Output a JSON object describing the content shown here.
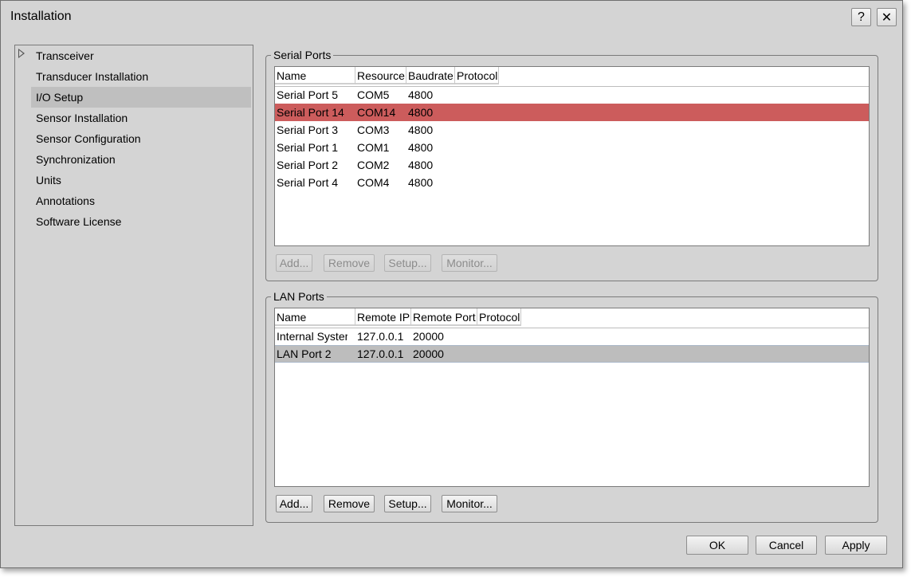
{
  "window": {
    "title": "Installation",
    "help_label": "?",
    "close_label": "✕"
  },
  "nav": {
    "items": [
      {
        "label": "Transceiver"
      },
      {
        "label": "Transducer Installation"
      },
      {
        "label": "I/O Setup"
      },
      {
        "label": "Sensor Installation"
      },
      {
        "label": "Sensor Configuration"
      },
      {
        "label": "Synchronization"
      },
      {
        "label": "Units"
      },
      {
        "label": "Annotations"
      },
      {
        "label": "Software License"
      }
    ],
    "selected": "I/O Setup"
  },
  "serial": {
    "label": "Serial Ports",
    "columns": [
      "Name",
      "Resource",
      "Baudrate",
      "Protocol"
    ],
    "rows": [
      {
        "name": "Serial Port 5",
        "resource": "COM5",
        "baudrate": "4800",
        "protocol": ""
      },
      {
        "name": "Serial Port 14",
        "resource": "COM14",
        "baudrate": "4800",
        "protocol": ""
      },
      {
        "name": "Serial Port 3",
        "resource": "COM3",
        "baudrate": "4800",
        "protocol": ""
      },
      {
        "name": "Serial Port 1",
        "resource": "COM1",
        "baudrate": "4800",
        "protocol": ""
      },
      {
        "name": "Serial Port 2",
        "resource": "COM2",
        "baudrate": "4800",
        "protocol": ""
      },
      {
        "name": "Serial Port 4",
        "resource": "COM4",
        "baudrate": "4800",
        "protocol": ""
      }
    ],
    "buttons": {
      "add": "Add...",
      "remove": "Remove",
      "setup": "Setup...",
      "monitor": "Monitor..."
    }
  },
  "lan": {
    "label": "LAN Ports",
    "columns": [
      "Name",
      "Remote IP",
      "Remote Port",
      "Protocol"
    ],
    "rows": [
      {
        "name": "Internal System",
        "remote_ip": "127.0.0.1",
        "remote_port": "20000",
        "protocol": ""
      },
      {
        "name": "LAN Port 2",
        "remote_ip": "127.0.0.1",
        "remote_port": "20000",
        "protocol": ""
      }
    ],
    "buttons": {
      "add": "Add...",
      "remove": "Remove",
      "setup": "Setup...",
      "monitor": "Monitor..."
    }
  },
  "dialog": {
    "ok": "OK",
    "cancel": "Cancel",
    "apply": "Apply"
  },
  "colors": {
    "selected_row": "#cc5c5c",
    "selected_row_inactive": "#bdbdbd",
    "background": "#d4d4d4"
  }
}
